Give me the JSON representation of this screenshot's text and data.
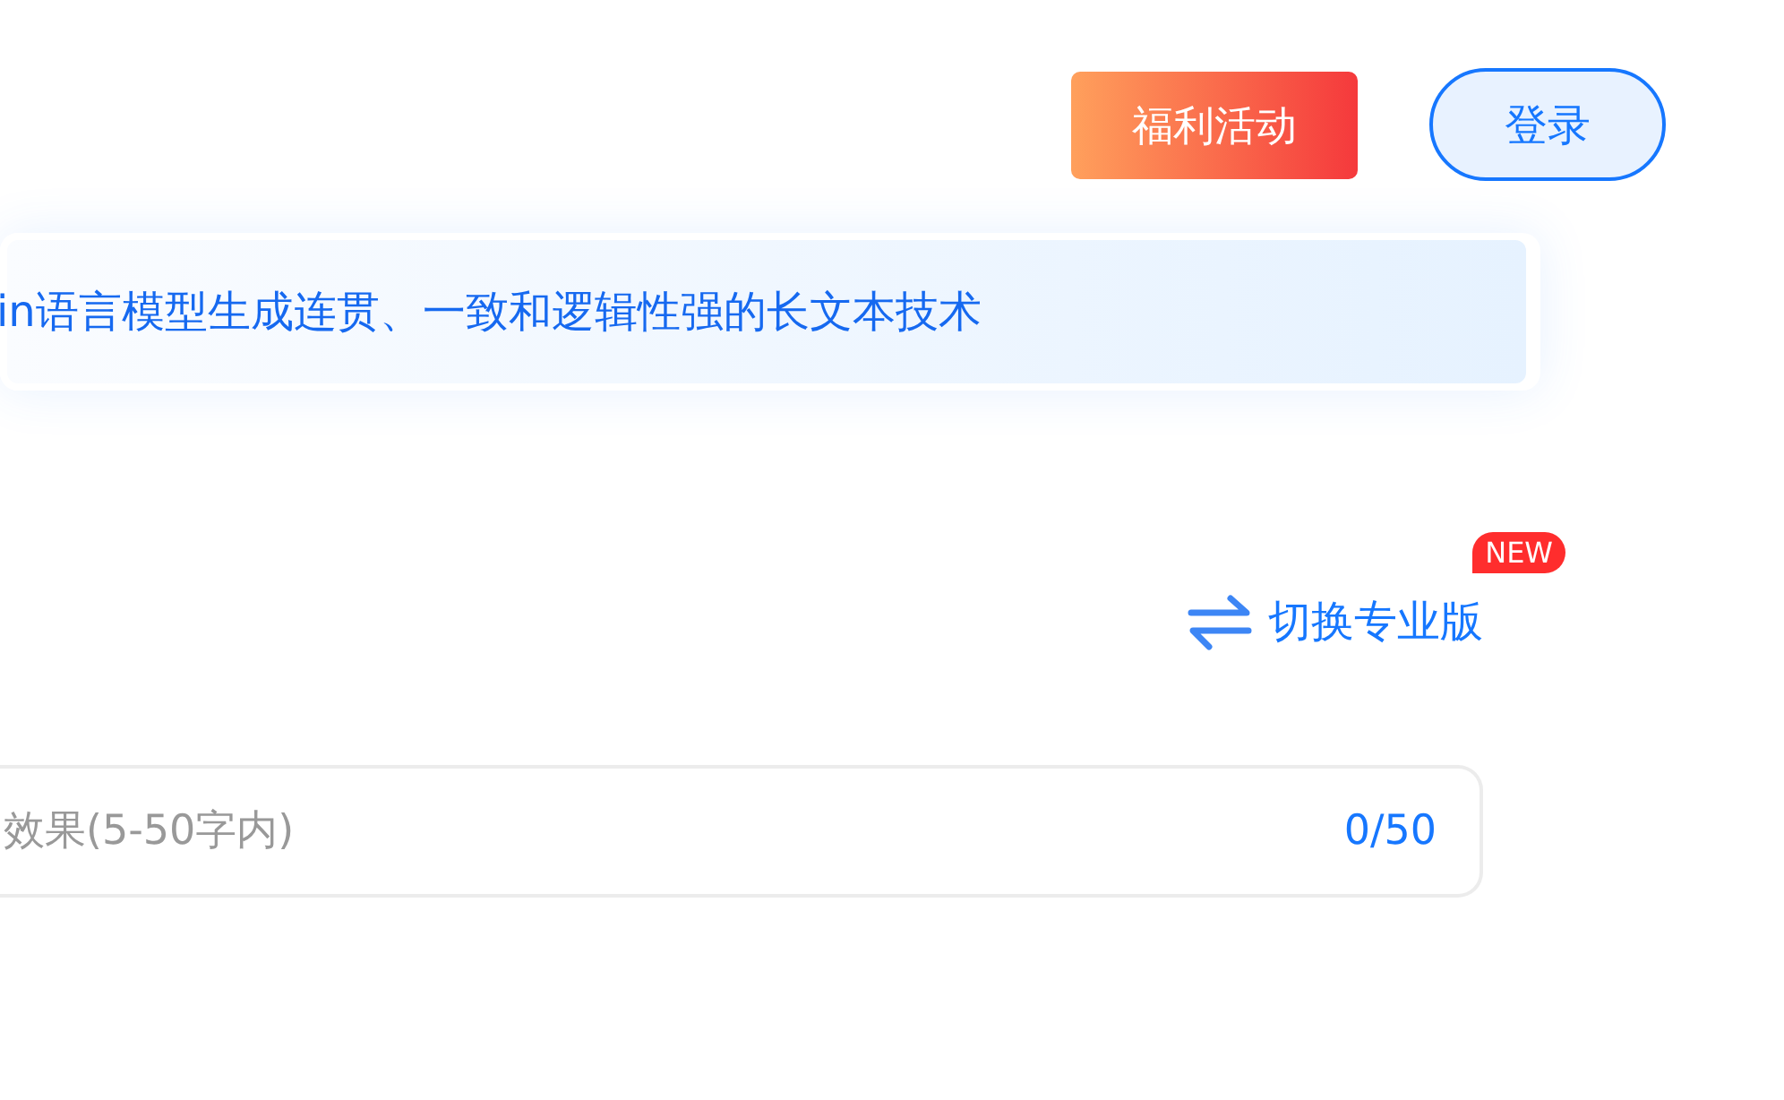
{
  "header": {
    "promo_button": "福利活动",
    "login_button": "登录"
  },
  "banner": {
    "text": "in语言模型生成连贯、一致和逻辑性强的长文本技术"
  },
  "mode_switch": {
    "label": "切换专业版",
    "badge": "NEW"
  },
  "input": {
    "placeholder": "效果(5-50字内)",
    "counter": "0/50"
  }
}
